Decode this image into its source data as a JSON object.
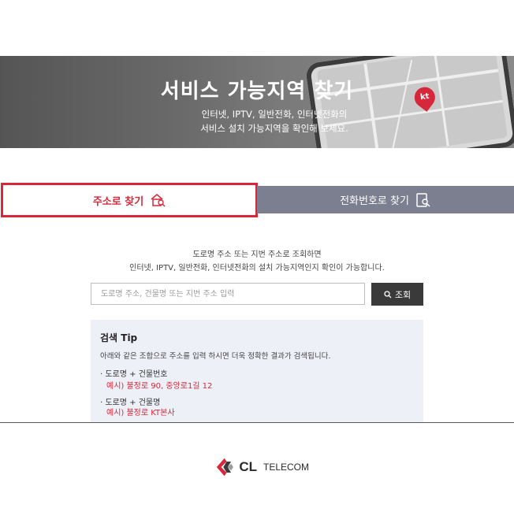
{
  "hero": {
    "title": "서비스 가능지역 찾기",
    "subtitle_line1": "인터넷, IPTV, 일반전화, 인터넷전화의",
    "subtitle_line2": "서비스 설치 가능지역을 확인해 보세요.",
    "pin_label": "kt"
  },
  "tabs": [
    {
      "label": "주소로 찾기",
      "icon": "house-search-icon",
      "active": true
    },
    {
      "label": "전화번호로 찾기",
      "icon": "phone-search-icon",
      "active": false
    }
  ],
  "guide": {
    "line1": "도로명 주소 또는 지번 주소로 조회하면",
    "line2": "인터넷, IPTV, 일반전화, 인터넷전화의 설치 가능지역인지 확인이 가능합니다."
  },
  "search": {
    "placeholder": "도로명 주소, 건물명 또는 지번 주소 입력",
    "button_label": "조회",
    "button_icon": "search-icon"
  },
  "tip": {
    "title": "검색 Tip",
    "description": "아래와 같은 조합으로 주소를 입력 하시면 더욱 정확한 결과가 검색됩니다.",
    "items": [
      {
        "label": "· 도로명 + 건물번호",
        "example": "예시) 불정로 90, 중앙로1길 12"
      },
      {
        "label": "· 도로명 + 건물명",
        "example": "예시) 불정로 KT본사"
      }
    ]
  },
  "brand": {
    "name_main": "CL",
    "name_sub": "TELECOM",
    "colors": {
      "accent": "#d6283a",
      "dark": "#2a2a2a"
    }
  }
}
